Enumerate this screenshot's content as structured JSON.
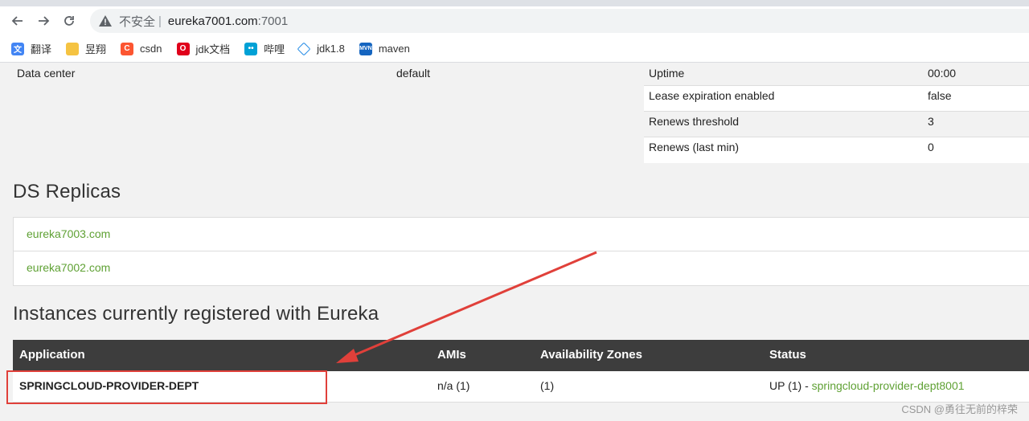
{
  "browser": {
    "address": {
      "insecure_label": "不安全",
      "separator": "|",
      "host": "eureka7001.com",
      "port": ":7001"
    },
    "bookmarks": [
      {
        "label": "翻译",
        "icon": "translate-icon",
        "color": "#4285f4"
      },
      {
        "label": "昱翔",
        "icon": "folder-icon",
        "color": "#f5c342"
      },
      {
        "label": "csdn",
        "icon": "csdn-icon",
        "color": "#fc5531"
      },
      {
        "label": "jdk文档",
        "icon": "oracle-icon",
        "color": "#e0001b"
      },
      {
        "label": "哔哩",
        "icon": "bilibili-icon",
        "color": "#00a1d6"
      },
      {
        "label": "jdk1.8",
        "icon": "code-icon",
        "color": "#1e88e5"
      },
      {
        "label": "maven",
        "icon": "maven-icon",
        "color": "#1565c0"
      }
    ]
  },
  "general": {
    "data_center_key": "Data center",
    "data_center_value": "default"
  },
  "stats": [
    {
      "key": "Uptime",
      "value": "00:00"
    },
    {
      "key": "Lease expiration enabled",
      "value": "false"
    },
    {
      "key": "Renews threshold",
      "value": "3"
    },
    {
      "key": "Renews (last min)",
      "value": "0"
    }
  ],
  "ds_replicas": {
    "title": "DS Replicas",
    "items": [
      "eureka7003.com",
      "eureka7002.com"
    ]
  },
  "instances": {
    "title": "Instances currently registered with Eureka",
    "columns": [
      "Application",
      "AMIs",
      "Availability Zones",
      "Status"
    ],
    "rows": [
      {
        "application": "SPRINGCLOUD-PROVIDER-DEPT",
        "amis": "n/a (1)",
        "zones": "(1)",
        "status_prefix": "UP (1) - ",
        "status_link": "springcloud-provider-dept8001"
      }
    ]
  },
  "colors": {
    "link_green": "#5fa134",
    "header_dark": "#3d3d3d",
    "annotation_red": "#e0403a"
  },
  "watermark": "CSDN @勇往无前的梓荣"
}
